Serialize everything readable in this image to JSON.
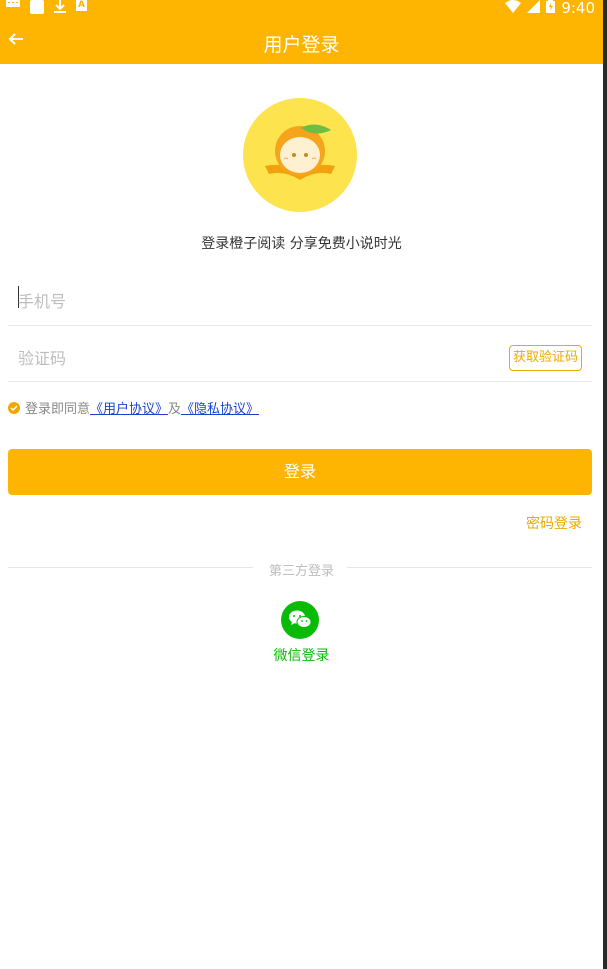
{
  "status_bar": {
    "time": "9:40",
    "icons": [
      "keyboard-icon",
      "sim-icon",
      "download-icon",
      "a-icon",
      "wifi-icon",
      "signal-icon",
      "battery-icon"
    ],
    "a_icon_text": "A"
  },
  "header": {
    "title": "用户登录",
    "back_icon": "arrow-left-icon"
  },
  "logo": {
    "icon": "orange-book-logo"
  },
  "slogan": "登录橙子阅读 分享免费小说时光",
  "form": {
    "phone_placeholder": "手机号",
    "code_placeholder": "验证码",
    "get_code_label": "获取验证码"
  },
  "agreement": {
    "prefix": "登录即同意",
    "user_agreement": "《用户协议》",
    "and": "及",
    "privacy_agreement": "《隐私协议》"
  },
  "login_button": "登录",
  "password_login": "密码登录",
  "third_party": {
    "title": "第三方登录",
    "wechat_label": "微信登录"
  },
  "colors": {
    "primary": "#fdb502",
    "accent": "#f0a800",
    "link": "#1a44c8",
    "wechat": "#09bb07"
  }
}
